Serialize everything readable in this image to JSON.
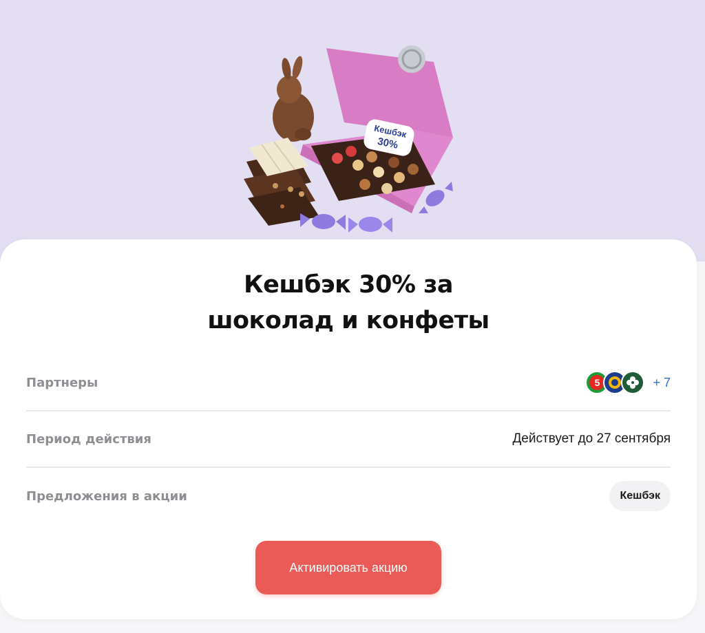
{
  "promo": {
    "title_line1": "Кешбэк 30% за",
    "title_line2": "шоколад и конфеты",
    "badge_text_line1": "Кешбэк",
    "badge_text_line2": "30%"
  },
  "details": {
    "partners_label": "Партнеры",
    "partners_more": "+ 7",
    "period_label": "Период действия",
    "period_value": "Действует до 27 сентября",
    "offers_label": "Предложения в акции",
    "offers_chip": "Кешбэк"
  },
  "partner_logos": [
    {
      "name": "pyaterochka-logo",
      "text": "5",
      "color": "#e52822",
      "ring": "#1e9a3a"
    },
    {
      "name": "perekrestok-logo",
      "color": "#f2b705",
      "ring": "#1d3b8f"
    },
    {
      "name": "karusel-logo",
      "color": "#1e5c3a",
      "ring": "#ffffff"
    }
  ],
  "cta": {
    "label": "Активировать акцию"
  },
  "colors": {
    "hero_bg": "#e3def1",
    "accent": "#ea5b57",
    "link": "#2f6fd6"
  }
}
